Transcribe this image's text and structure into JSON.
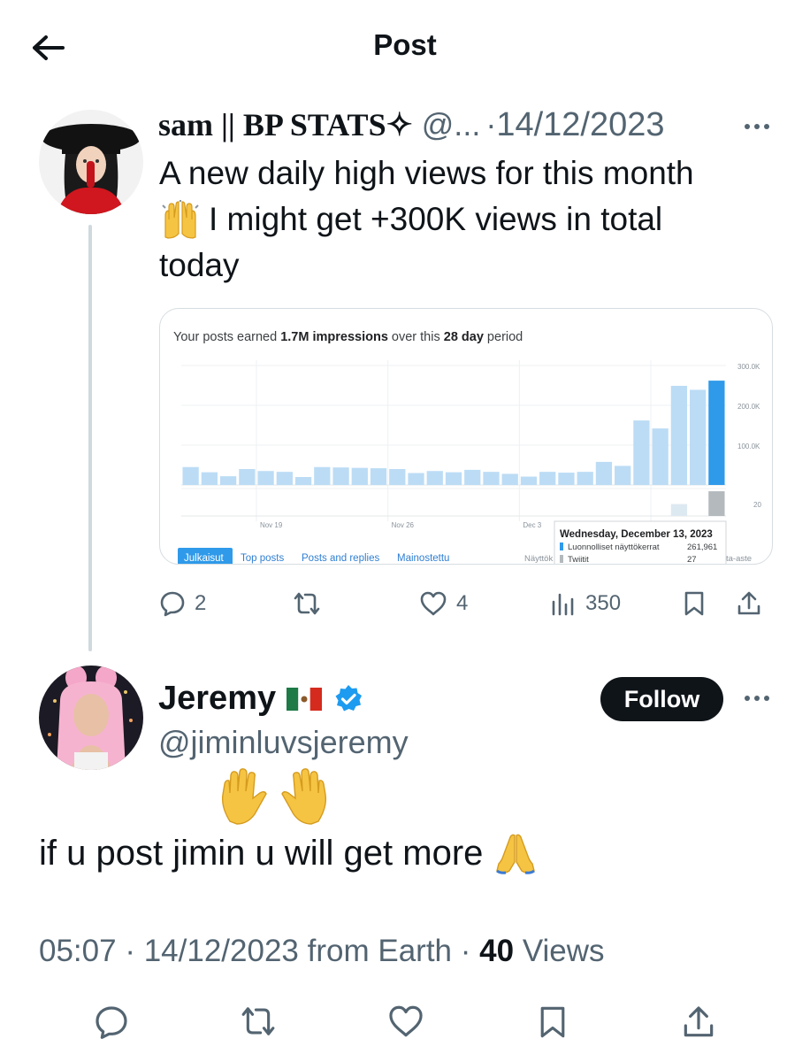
{
  "header": {
    "title": "Post"
  },
  "post": {
    "author_name": "sam || BP STATS✧",
    "handle_truncated": "@...",
    "separator": "·",
    "date": "14/12/2023",
    "text_line1": "A new daily high views for this month",
    "text_line2": "I might get +300K views in total",
    "text_line3": "today",
    "emoji_line2": "raising-hands",
    "stats": {
      "replies": "2",
      "likes": "4",
      "views": "350"
    }
  },
  "analytics_card": {
    "intro_prefix": "Your posts earned ",
    "intro_value": "1.7M impressions",
    "intro_mid": " over this ",
    "intro_period": "28 day",
    "intro_suffix": " period",
    "tabs": [
      "Julkaisut",
      "Top posts",
      "Posts and replies",
      "Mainostettu"
    ],
    "truncated_left": "Näyttök",
    "truncated_right": "ta-aste",
    "tooltip": {
      "title": "Wednesday, December 13, 2023",
      "row1_label": "Luonnolliset näyttökerrat",
      "row1_value": "261,961",
      "row2_label": "Twiitit",
      "row2_value": "27"
    }
  },
  "chart_data": {
    "type": "bar",
    "x_tick_labels": [
      "Nov 19",
      "Nov 26",
      "Dec 3"
    ],
    "y_tick_labels": [
      "300.0K",
      "200.0K",
      "100.0K"
    ],
    "ylim": [
      0,
      300000
    ],
    "series": [
      {
        "name": "Luonnolliset näyttökerrat",
        "values": [
          45000,
          32000,
          22000,
          40000,
          35000,
          33000,
          20000,
          45000,
          44000,
          43000,
          42000,
          40000,
          30000,
          35000,
          32000,
          38000,
          33000,
          28000,
          21000,
          33000,
          31000,
          33000,
          58000,
          48000,
          162000,
          142000,
          249000,
          239000,
          262000
        ]
      },
      {
        "name": "Twiitit",
        "values": [
          0,
          0,
          0,
          0,
          0,
          0,
          0,
          0,
          0,
          0,
          0,
          0,
          0,
          0,
          0,
          0,
          0,
          0,
          0,
          0,
          0,
          0,
          0,
          0,
          0,
          0,
          13,
          0,
          27
        ]
      }
    ],
    "secondary_axis_label": "20",
    "highlighted_index": 28,
    "colors": {
      "bar": "#bcdcf5",
      "bar_selected": "#2f9ae9",
      "secondary": "#dde9f1",
      "secondary_selected": "#b3b9bd"
    }
  },
  "reply": {
    "name": "Jeremy",
    "flag_emoji": "🇲🇽",
    "verified": "verified-badge",
    "handle": "@jiminluvsjeremy",
    "follow_label": "Follow",
    "emoji_top": "waving-hands",
    "text": "if u post jimin u will get more",
    "emoji_end": "folded-hands",
    "time": "05:07",
    "separator": "·",
    "date": "14/12/2023",
    "location": "from Earth",
    "views_count": "40",
    "views_label": "Views"
  },
  "colors": {
    "accent": "#1d9bf0",
    "text": "#0f1419",
    "muted": "#536471",
    "follow_bg": "#0f1419"
  }
}
